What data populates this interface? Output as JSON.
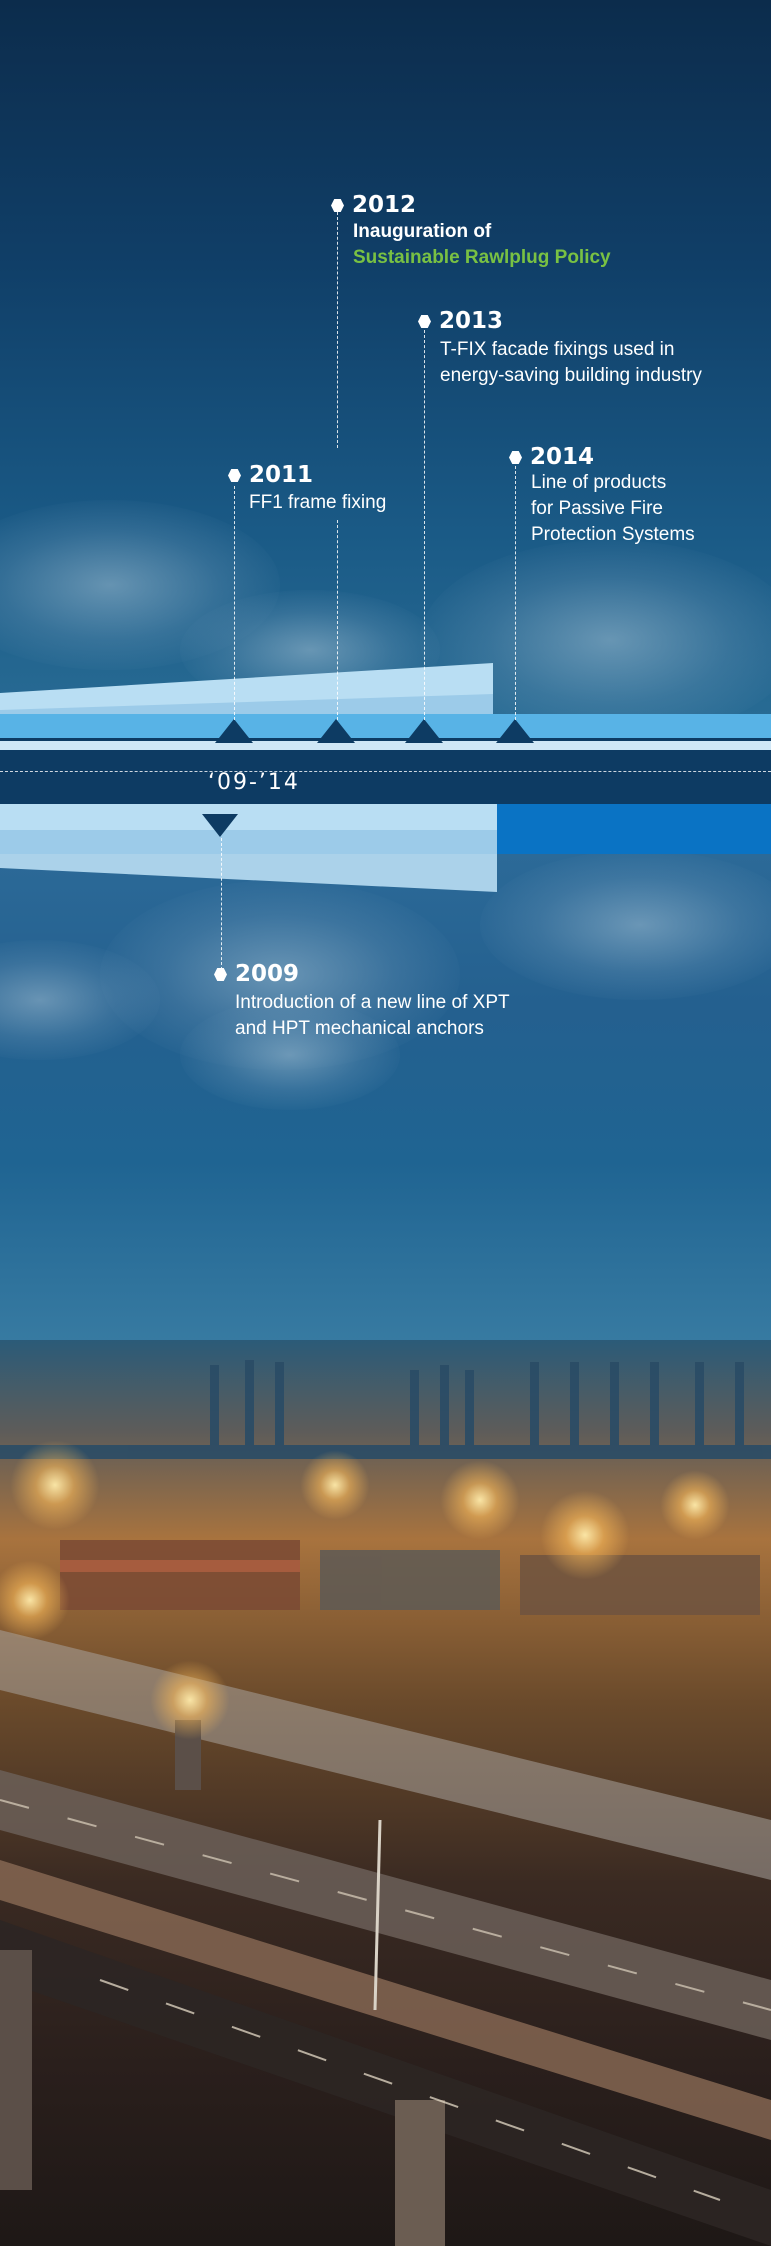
{
  "timeline": {
    "period_label": "‘09-’14",
    "events": [
      {
        "year": "2012",
        "line1": "Inauguration of",
        "line2": "Sustainable Rawlplug Policy"
      },
      {
        "year": "2013",
        "line1": "T-FIX facade fixings used in",
        "line2": "energy-saving building industry"
      },
      {
        "year": "2011",
        "line1": "FF1 frame fixing"
      },
      {
        "year": "2014",
        "line1": "Line of products",
        "line2": "for Passive Fire",
        "line3": "Protection Systems"
      },
      {
        "year": "2009",
        "line1": "Introduction of a new line of XPT",
        "line2": "and HPT mechanical anchors"
      }
    ]
  },
  "colors": {
    "accent_green": "#79c143",
    "band_light_blue": "#58b3e6",
    "band_pale_blue": "#b9def3",
    "band_navy": "#0d3b63",
    "band_bright_blue": "#0a73c4"
  }
}
